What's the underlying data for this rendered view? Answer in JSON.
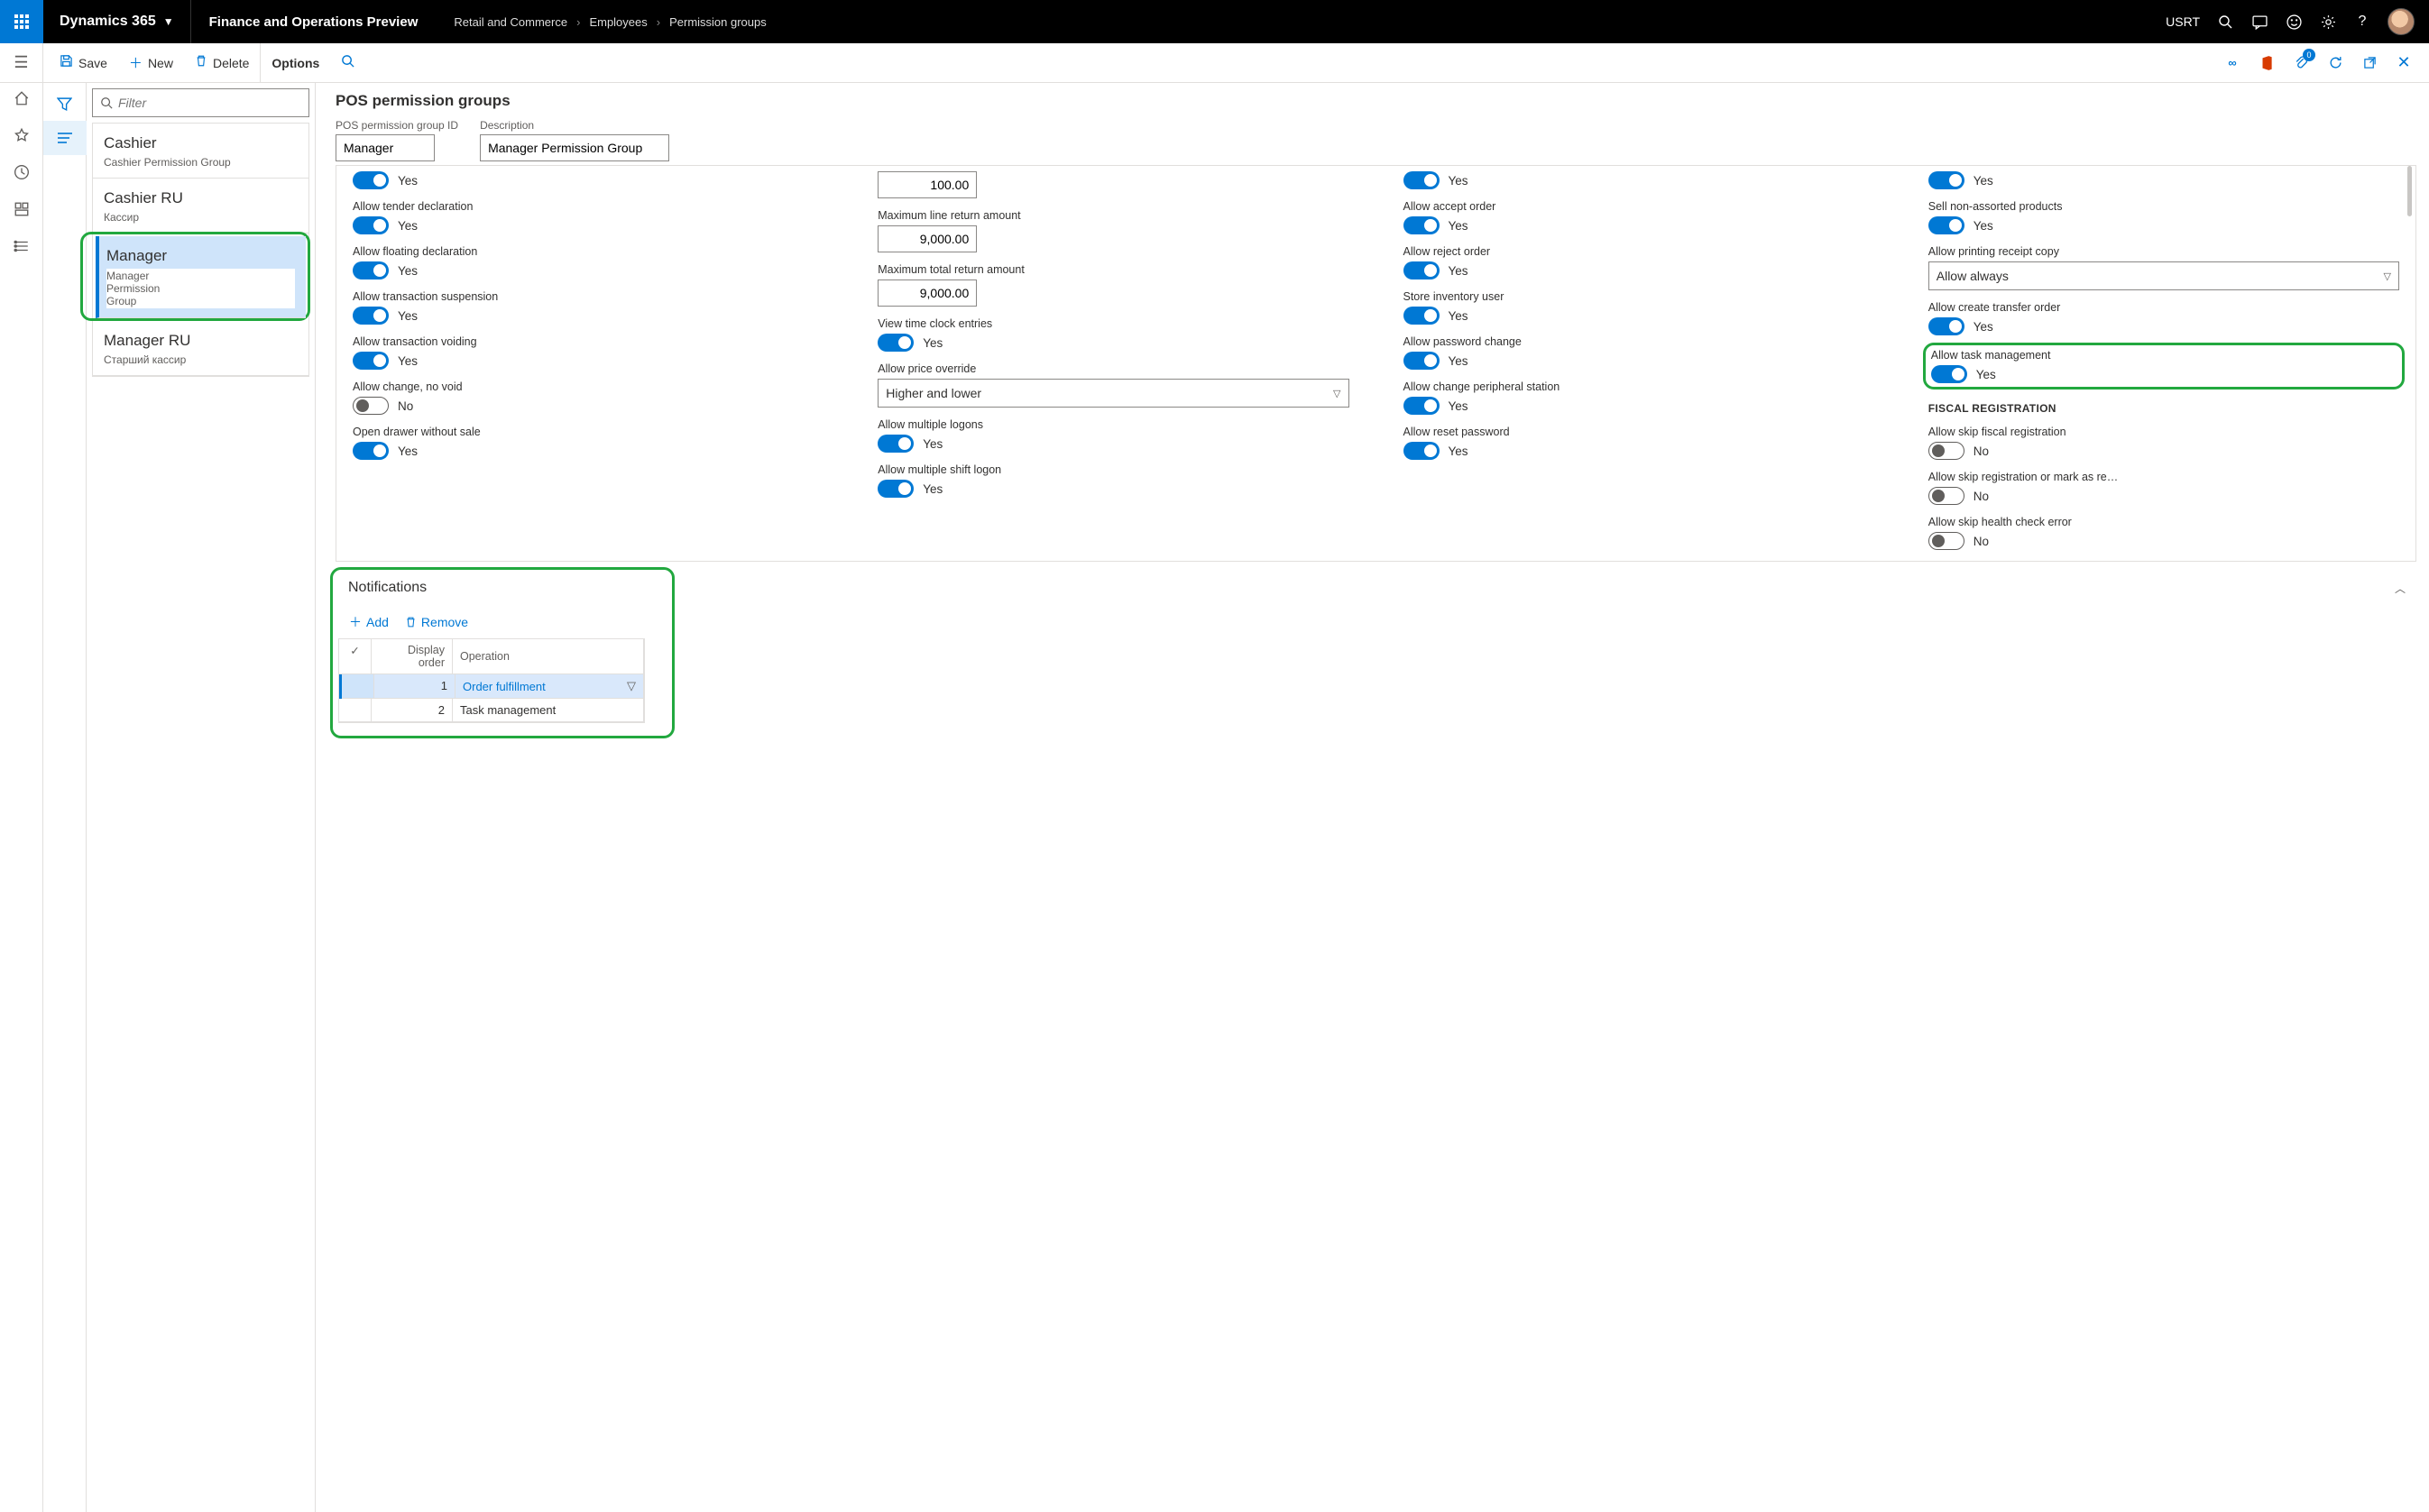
{
  "brand": "Dynamics 365",
  "app_title": "Finance and Operations Preview",
  "breadcrumbs": [
    "Retail and Commerce",
    "Employees",
    "Permission groups"
  ],
  "company": "USRT",
  "cmd": {
    "save": "Save",
    "new": "New",
    "delete": "Delete",
    "options": "Options"
  },
  "notif_badge": "0",
  "filter_placeholder": "Filter",
  "list": [
    {
      "title": "Cashier",
      "sub": "Cashier Permission Group"
    },
    {
      "title": "Cashier RU",
      "sub": "Кассир"
    },
    {
      "title": "Manager",
      "sub": "Manager Permission Group"
    },
    {
      "title": "Manager RU",
      "sub": "Старший кассир"
    }
  ],
  "page_title": "POS permission groups",
  "hf": {
    "id_label": "POS permission group ID",
    "id_value": "Manager",
    "desc_label": "Description",
    "desc_value": "Manager Permission Group"
  },
  "col1": {
    "f0": {
      "value": "Yes"
    },
    "f1": {
      "label": "Allow tender declaration",
      "value": "Yes"
    },
    "f2": {
      "label": "Allow floating declaration",
      "value": "Yes"
    },
    "f3": {
      "label": "Allow transaction suspension",
      "value": "Yes"
    },
    "f4": {
      "label": "Allow transaction voiding",
      "value": "Yes"
    },
    "f5": {
      "label": "Allow change, no void",
      "value": "No"
    },
    "f6": {
      "label": "Open drawer without sale",
      "value": "Yes"
    }
  },
  "col2": {
    "n1": {
      "value": "100.00"
    },
    "n2": {
      "label": "Maximum line return amount",
      "value": "9,000.00"
    },
    "n3": {
      "label": "Maximum total return amount",
      "value": "9,000.00"
    },
    "t1": {
      "label": "View time clock entries",
      "value": "Yes"
    },
    "s1": {
      "label": "Allow price override",
      "value": "Higher and lower"
    },
    "t2": {
      "label": "Allow multiple logons",
      "value": "Yes"
    },
    "t3": {
      "label": "Allow multiple shift logon",
      "value": "Yes"
    }
  },
  "col3": {
    "f0": {
      "value": "Yes"
    },
    "f1": {
      "label": "Allow accept order",
      "value": "Yes"
    },
    "f2": {
      "label": "Allow reject order",
      "value": "Yes"
    },
    "f3": {
      "label": "Store inventory user",
      "value": "Yes"
    },
    "f4": {
      "label": "Allow password change",
      "value": "Yes"
    },
    "f5": {
      "label": "Allow change peripheral station",
      "value": "Yes"
    },
    "f6": {
      "label": "Allow reset password",
      "value": "Yes"
    }
  },
  "col4": {
    "f0": {
      "value": "Yes"
    },
    "f1": {
      "label": "Sell non-assorted products",
      "value": "Yes"
    },
    "s1": {
      "label": "Allow printing receipt copy",
      "value": "Allow always"
    },
    "f2": {
      "label": "Allow create transfer order",
      "value": "Yes"
    },
    "f3": {
      "label": "Allow task management",
      "value": "Yes"
    },
    "section": "FISCAL REGISTRATION",
    "f4": {
      "label": "Allow skip fiscal registration",
      "value": "No"
    },
    "f5": {
      "label": "Allow skip registration or mark as re…",
      "value": "No"
    },
    "f6": {
      "label": "Allow skip health check error",
      "value": "No"
    }
  },
  "notifications": {
    "title": "Notifications",
    "add": "Add",
    "remove": "Remove",
    "headers": {
      "order": "Display order",
      "op": "Operation"
    },
    "rows": [
      {
        "order": "1",
        "op": "Order fulfillment"
      },
      {
        "order": "2",
        "op": "Task management"
      }
    ]
  }
}
